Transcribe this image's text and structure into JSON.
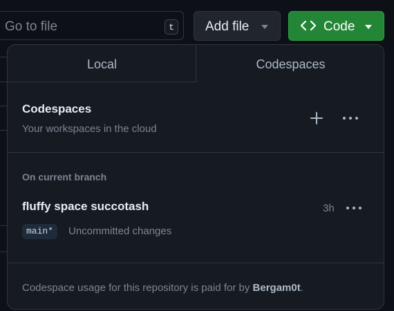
{
  "toolbar": {
    "search_placeholder": "Go to file",
    "search_shortcut": "t",
    "add_file_label": "Add file",
    "code_label": "Code"
  },
  "popover": {
    "tabs": [
      {
        "label": "Local",
        "selected": false
      },
      {
        "label": "Codespaces",
        "selected": true
      }
    ],
    "header": {
      "title": "Codespaces",
      "subtitle": "Your workspaces in the cloud"
    },
    "section_label": "On current branch",
    "codespace": {
      "name": "fluffy space succotash",
      "age": "3h",
      "branch": "main*",
      "status": "Uncommitted changes"
    },
    "footer": {
      "text": "Codespace usage for this repository is paid for by ",
      "owner": "Bergam0t",
      "suffix": "."
    }
  },
  "colors": {
    "background": "#0d1117",
    "popover_bg": "#161b22",
    "border": "#30363d",
    "code_button": "#238636",
    "muted_text": "#7d8590"
  }
}
